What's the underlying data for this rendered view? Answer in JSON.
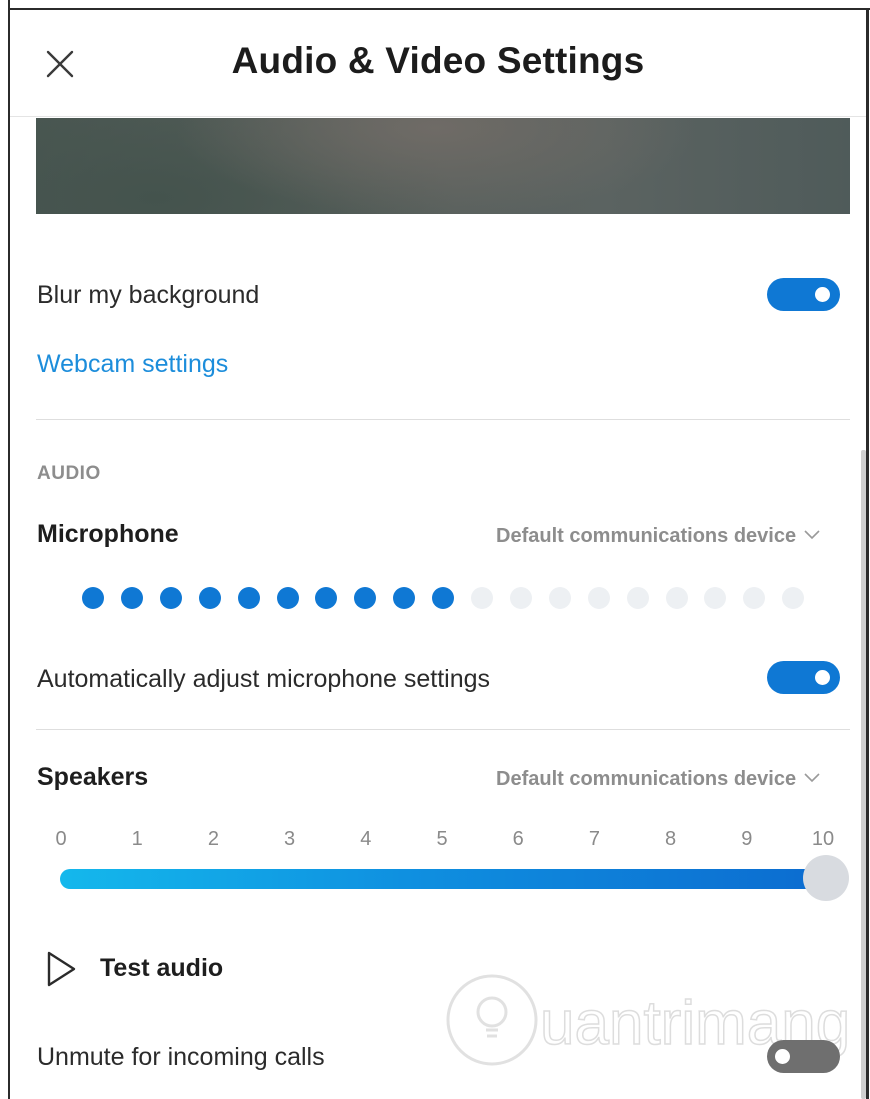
{
  "header": {
    "title": "Audio & Video Settings"
  },
  "video": {
    "blur_label": "Blur my background",
    "blur_enabled": true,
    "webcam_link": "Webcam settings"
  },
  "audio": {
    "section_label": "AUDIO",
    "microphone": {
      "heading": "Microphone",
      "device": "Default communications device",
      "level_dots_total": 19,
      "level_dots_active": 10,
      "auto_adjust_label": "Automatically adjust microphone settings",
      "auto_adjust_enabled": true
    },
    "speakers": {
      "heading": "Speakers",
      "device": "Default communications device",
      "ticks": [
        "0",
        "1",
        "2",
        "3",
        "4",
        "5",
        "6",
        "7",
        "8",
        "9",
        "10"
      ],
      "volume": 10,
      "test_audio_label": "Test audio",
      "unmute_label": "Unmute for incoming calls",
      "unmute_enabled": false
    }
  },
  "watermark": {
    "text": "uantrimang"
  },
  "colors": {
    "accent": "#0f78d4",
    "link": "#1c8ddb",
    "muted": "#8d8d8d"
  },
  "icons": {
    "close": "close-icon",
    "chevron": "chevron-down-icon",
    "play": "play-icon",
    "watermark": "lightbulb-icon"
  }
}
